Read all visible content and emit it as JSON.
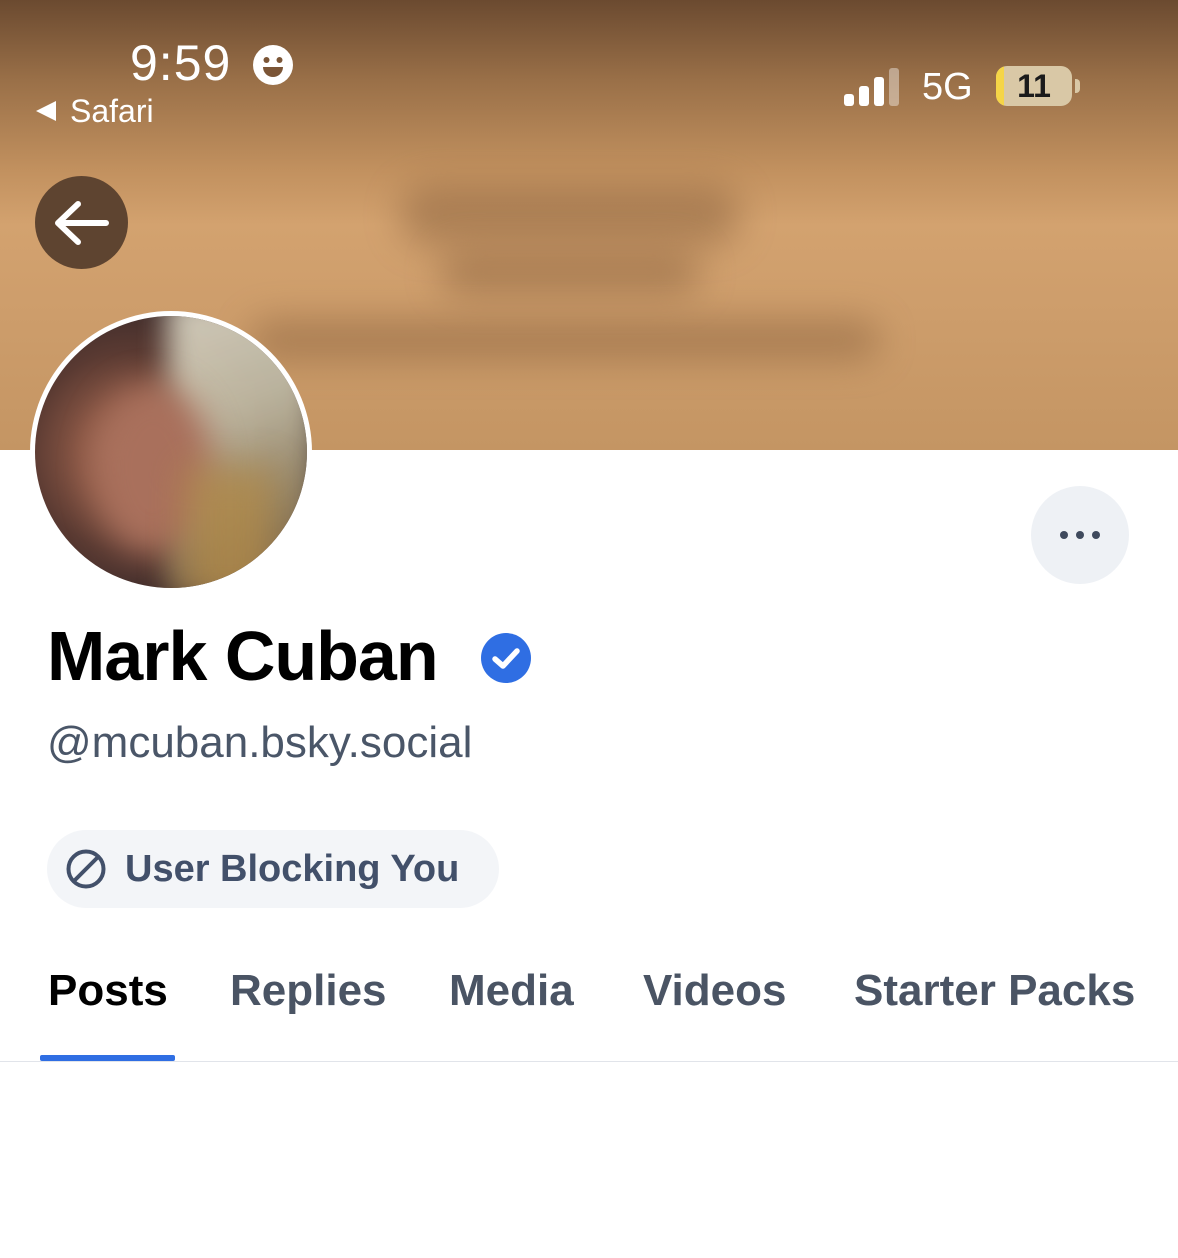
{
  "status_bar": {
    "time": "9:59",
    "back_app": "Safari",
    "network": "5G",
    "battery": "11",
    "battery_level_percent": 11
  },
  "profile": {
    "display_name": "Mark Cuban",
    "handle": "@mcuban.bsky.social",
    "verified": true,
    "block_status": "User Blocking You"
  },
  "tabs": [
    {
      "label": "Posts",
      "active": true
    },
    {
      "label": "Replies",
      "active": false
    },
    {
      "label": "Media",
      "active": false
    },
    {
      "label": "Videos",
      "active": false
    },
    {
      "label": "Starter Packs",
      "active": false
    }
  ],
  "icons": {
    "back": "arrow-left-icon",
    "more": "ellipsis-icon",
    "verified": "verified-check-icon",
    "block": "block-icon",
    "status": "smiley-icon"
  },
  "colors": {
    "accent": "#2f6ee3",
    "verified": "#2f6ee3",
    "text_secondary": "#4a5668",
    "badge_bg": "#f3f5f8"
  }
}
